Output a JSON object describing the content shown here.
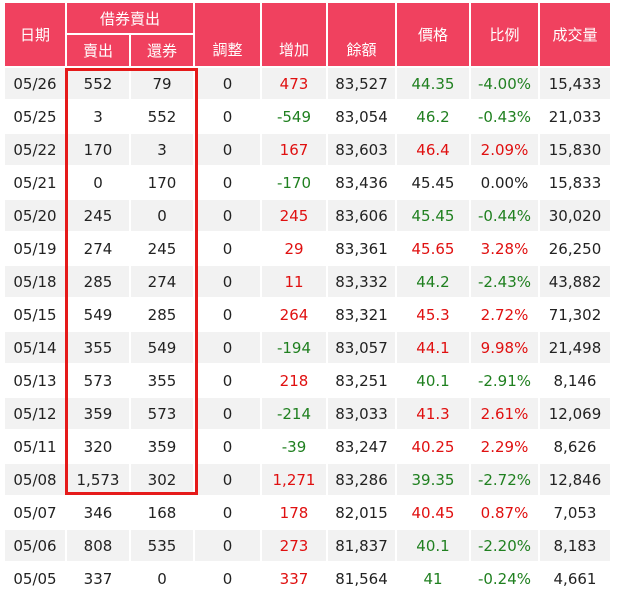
{
  "headers": {
    "date": "日期",
    "short_group": "借券賣出",
    "sell": "賣出",
    "return": "還券",
    "adjust": "調整",
    "increase": "增加",
    "balance": "餘額",
    "price": "價格",
    "ratio": "比例",
    "volume": "成交量"
  },
  "colors": {
    "header_bg": "#f0415f",
    "up": "#e01010",
    "down": "#208020",
    "highlight_box": "#e51a1a"
  },
  "rows": [
    {
      "date": "05/26",
      "sell": "552",
      "return": "79",
      "adjust": "0",
      "increase": "473",
      "balance": "83,527",
      "price": "44.35",
      "ratio": "-4.00%",
      "volume": "15,433",
      "inc_color": "red",
      "price_color": "green",
      "ratio_color": "green"
    },
    {
      "date": "05/25",
      "sell": "3",
      "return": "552",
      "adjust": "0",
      "increase": "-549",
      "balance": "83,054",
      "price": "46.2",
      "ratio": "-0.43%",
      "volume": "21,033",
      "inc_color": "green",
      "price_color": "green",
      "ratio_color": "green"
    },
    {
      "date": "05/22",
      "sell": "170",
      "return": "3",
      "adjust": "0",
      "increase": "167",
      "balance": "83,603",
      "price": "46.4",
      "ratio": "2.09%",
      "volume": "15,830",
      "inc_color": "red",
      "price_color": "red",
      "ratio_color": "red"
    },
    {
      "date": "05/21",
      "sell": "0",
      "return": "170",
      "adjust": "0",
      "increase": "-170",
      "balance": "83,436",
      "price": "45.45",
      "ratio": "0.00%",
      "volume": "15,833",
      "inc_color": "green",
      "price_color": "neutral",
      "ratio_color": "neutral"
    },
    {
      "date": "05/20",
      "sell": "245",
      "return": "0",
      "adjust": "0",
      "increase": "245",
      "balance": "83,606",
      "price": "45.45",
      "ratio": "-0.44%",
      "volume": "30,020",
      "inc_color": "red",
      "price_color": "green",
      "ratio_color": "green"
    },
    {
      "date": "05/19",
      "sell": "274",
      "return": "245",
      "adjust": "0",
      "increase": "29",
      "balance": "83,361",
      "price": "45.65",
      "ratio": "3.28%",
      "volume": "26,250",
      "inc_color": "red",
      "price_color": "red",
      "ratio_color": "red"
    },
    {
      "date": "05/18",
      "sell": "285",
      "return": "274",
      "adjust": "0",
      "increase": "11",
      "balance": "83,332",
      "price": "44.2",
      "ratio": "-2.43%",
      "volume": "43,882",
      "inc_color": "red",
      "price_color": "green",
      "ratio_color": "green"
    },
    {
      "date": "05/15",
      "sell": "549",
      "return": "285",
      "adjust": "0",
      "increase": "264",
      "balance": "83,321",
      "price": "45.3",
      "ratio": "2.72%",
      "volume": "71,302",
      "inc_color": "red",
      "price_color": "red",
      "ratio_color": "red"
    },
    {
      "date": "05/14",
      "sell": "355",
      "return": "549",
      "adjust": "0",
      "increase": "-194",
      "balance": "83,057",
      "price": "44.1",
      "ratio": "9.98%",
      "volume": "21,498",
      "inc_color": "green",
      "price_color": "red",
      "ratio_color": "red"
    },
    {
      "date": "05/13",
      "sell": "573",
      "return": "355",
      "adjust": "0",
      "increase": "218",
      "balance": "83,251",
      "price": "40.1",
      "ratio": "-2.91%",
      "volume": "8,146",
      "inc_color": "red",
      "price_color": "green",
      "ratio_color": "green"
    },
    {
      "date": "05/12",
      "sell": "359",
      "return": "573",
      "adjust": "0",
      "increase": "-214",
      "balance": "83,033",
      "price": "41.3",
      "ratio": "2.61%",
      "volume": "12,069",
      "inc_color": "green",
      "price_color": "red",
      "ratio_color": "red"
    },
    {
      "date": "05/11",
      "sell": "320",
      "return": "359",
      "adjust": "0",
      "increase": "-39",
      "balance": "83,247",
      "price": "40.25",
      "ratio": "2.29%",
      "volume": "8,626",
      "inc_color": "green",
      "price_color": "red",
      "ratio_color": "red"
    },
    {
      "date": "05/08",
      "sell": "1,573",
      "return": "302",
      "adjust": "0",
      "increase": "1,271",
      "balance": "83,286",
      "price": "39.35",
      "ratio": "-2.72%",
      "volume": "12,846",
      "inc_color": "red",
      "price_color": "green",
      "ratio_color": "green"
    },
    {
      "date": "05/07",
      "sell": "346",
      "return": "168",
      "adjust": "0",
      "increase": "178",
      "balance": "82,015",
      "price": "40.45",
      "ratio": "0.87%",
      "volume": "7,053",
      "inc_color": "red",
      "price_color": "red",
      "ratio_color": "red"
    },
    {
      "date": "05/06",
      "sell": "808",
      "return": "535",
      "adjust": "0",
      "increase": "273",
      "balance": "81,837",
      "price": "40.1",
      "ratio": "-2.20%",
      "volume": "8,183",
      "inc_color": "red",
      "price_color": "green",
      "ratio_color": "green"
    },
    {
      "date": "05/05",
      "sell": "337",
      "return": "0",
      "adjust": "0",
      "increase": "337",
      "balance": "81,564",
      "price": "41",
      "ratio": "-0.24%",
      "volume": "4,661",
      "inc_color": "red",
      "price_color": "green",
      "ratio_color": "green"
    }
  ]
}
